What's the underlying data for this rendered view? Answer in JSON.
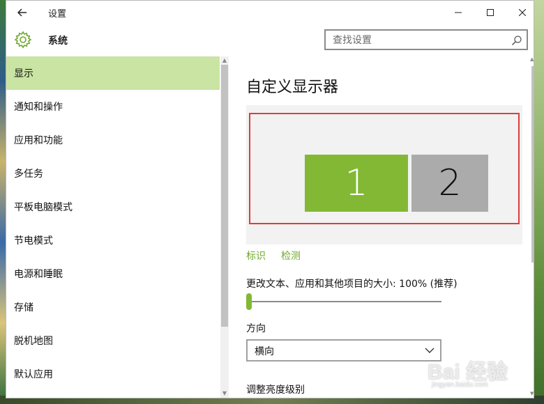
{
  "window": {
    "title": "设置",
    "controls": {
      "minimize": "minimize-icon",
      "maximize": "maximize-icon",
      "close": "close-icon"
    }
  },
  "header": {
    "icon": "gear-icon",
    "section_title": "系统",
    "search_placeholder": "查找设置"
  },
  "sidebar": {
    "items": [
      {
        "label": "显示",
        "active": true
      },
      {
        "label": "通知和操作"
      },
      {
        "label": "应用和功能"
      },
      {
        "label": "多任务"
      },
      {
        "label": "平板电脑模式"
      },
      {
        "label": "节电模式"
      },
      {
        "label": "电源和睡眠"
      },
      {
        "label": "存储"
      },
      {
        "label": "脱机地图"
      },
      {
        "label": "默认应用"
      }
    ]
  },
  "content": {
    "title": "自定义显示器",
    "monitors": [
      {
        "label": "1",
        "selected": true
      },
      {
        "label": "2",
        "selected": false
      }
    ],
    "links": {
      "identify": "标识",
      "detect": "检测"
    },
    "scale_label": "更改文本、应用和其他项目的大小: 100% (推荐)",
    "scale_slider_value": 0,
    "orientation_label": "方向",
    "orientation_value": "横向",
    "brightness_label": "调整亮度级别"
  },
  "watermark": {
    "text": "Bai 经验",
    "sub": "jingyan.baidu.com"
  },
  "colors": {
    "accent": "#83b834",
    "active_nav": "#c9e4a3",
    "highlight": "#e03c3c",
    "monitor2": "#ababab"
  }
}
